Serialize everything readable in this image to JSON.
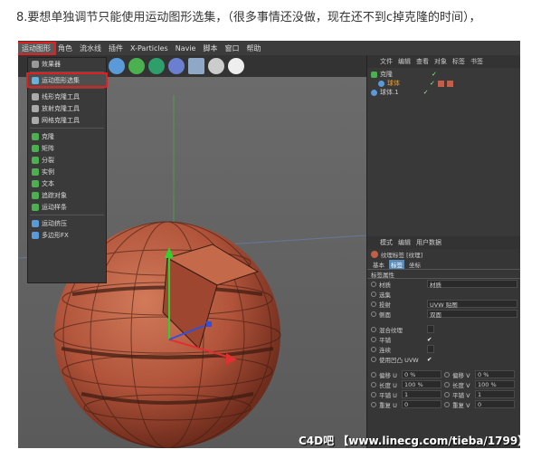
{
  "caption": "8.要想单独调节只能使用运动图形选集，（很多事情还没做，现在还不到c掉克隆的时间），",
  "menubar": [
    "运动图形",
    "角色",
    "流水线",
    "插件",
    "X-Particles",
    "Navie",
    "脚本",
    "窗口",
    "帮助"
  ],
  "dropdown": {
    "items": [
      "效果器",
      "运动图形选集",
      "线形克隆工具",
      "放射克隆工具",
      "网格克隆工具",
      "克隆",
      "矩阵",
      "分裂",
      "实例",
      "文本",
      "追踪对象",
      "运动样条",
      "运动挤压",
      "多边形FX"
    ]
  },
  "objects": {
    "menu": [
      "文件",
      "编辑",
      "查看",
      "对象",
      "标签",
      "书签"
    ],
    "rows": [
      "克隆",
      "球体",
      "球体.1"
    ]
  },
  "attributes": {
    "menu": [
      "模式",
      "编辑",
      "用户数据"
    ],
    "title": "纹理标签 [纹理]",
    "tabs": [
      "基本",
      "标签",
      "坐标"
    ],
    "section": "标签属性",
    "fields": [
      {
        "label": "材质",
        "value": "材质"
      },
      {
        "label": "选集",
        "value": ""
      },
      {
        "label": "投射",
        "value": "UVW 贴图"
      },
      {
        "label": "侧面",
        "value": "双面"
      }
    ],
    "checks": [
      "混合纹理",
      "平铺",
      "连续",
      "使用凹凸 UVW"
    ],
    "pairs": [
      {
        "l1": "偏移 U",
        "v1": "0 %",
        "l2": "偏移 V",
        "v2": "0 %"
      },
      {
        "l1": "长度 U",
        "v1": "100 %",
        "l2": "长度 V",
        "v2": "100 %"
      },
      {
        "l1": "平铺 U",
        "v1": "1",
        "l2": "平铺 V",
        "v2": "1"
      },
      {
        "l1": "重复 U",
        "v1": "0",
        "l2": "重复 V",
        "v2": "0"
      }
    ]
  },
  "watermark": "C4D吧 【www.linecg.com/tieba/1799】"
}
